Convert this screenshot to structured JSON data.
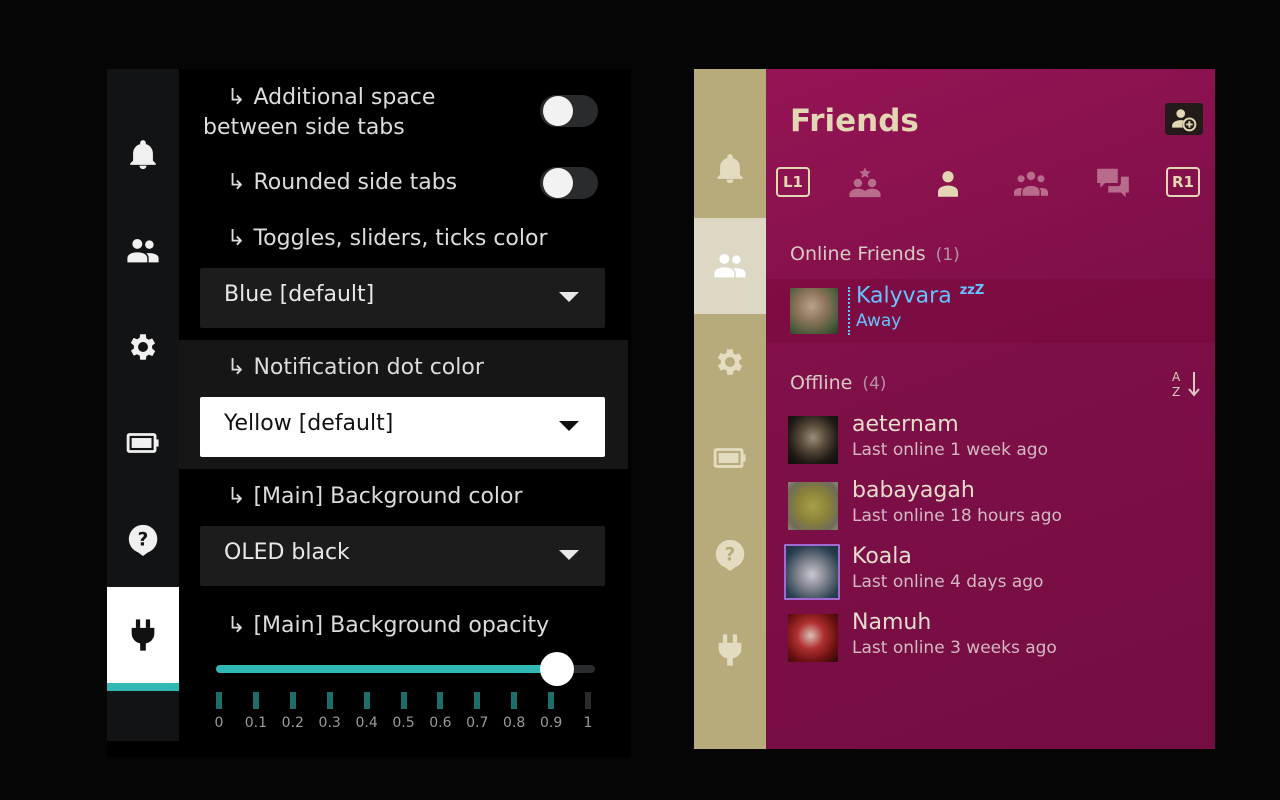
{
  "left": {
    "sidebar": [
      {
        "icon": "bell-icon",
        "active": false
      },
      {
        "icon": "friends-icon",
        "active": false
      },
      {
        "icon": "gear-icon",
        "active": false
      },
      {
        "icon": "battery-icon",
        "active": false
      },
      {
        "icon": "help-icon",
        "active": false
      },
      {
        "icon": "plug-icon",
        "active": true
      }
    ],
    "settings": {
      "additional_space_line1": "Additional space",
      "additional_space_line2": "between side tabs",
      "rounded_side_tabs": "Rounded side tabs",
      "toggles_color_label": "Toggles, sliders, ticks color",
      "toggles_color_value": "Blue [default]",
      "notif_dot_label": "Notification dot color",
      "notif_dot_value": "Yellow [default]",
      "bg_color_label": "[Main] Background color",
      "bg_color_value": "OLED black",
      "bg_opacity_label": "[Main] Background opacity",
      "arrow": "↳",
      "additional_space_on": false,
      "rounded_side_tabs_on": false
    },
    "slider": {
      "value": 0.9,
      "ticks": [
        "0",
        "0.1",
        "0.2",
        "0.3",
        "0.4",
        "0.5",
        "0.6",
        "0.7",
        "0.8",
        "0.9",
        "1"
      ]
    },
    "accent_color": "#2fb8b4"
  },
  "right": {
    "sidebar": [
      {
        "icon": "bell-icon",
        "active": false
      },
      {
        "icon": "friends-icon",
        "active": true
      },
      {
        "icon": "gear-icon",
        "active": false
      },
      {
        "icon": "battery-icon",
        "active": false
      },
      {
        "icon": "help-icon",
        "active": false
      },
      {
        "icon": "plug-icon",
        "active": false
      }
    ],
    "title": "Friends",
    "tabs": {
      "l1": "L1",
      "r1": "R1",
      "items": [
        "favorites-icon",
        "friend-icon",
        "groups-icon",
        "chat-icon"
      ],
      "active_index": 1
    },
    "online_header": "Online Friends",
    "online_count": "(1)",
    "online_friends": [
      {
        "name": "Kalyvara",
        "zzz": "zzZ",
        "status": "Away"
      }
    ],
    "offline_header": "Offline",
    "offline_count": "(4)",
    "offline_friends": [
      {
        "name": "aeternam",
        "status": "Last online 1 week ago"
      },
      {
        "name": "babayagah",
        "status": "Last online 18 hours ago"
      },
      {
        "name": "Koala",
        "status": "Last online 4 days ago"
      },
      {
        "name": "Namuh",
        "status": "Last online 3 weeks ago"
      }
    ],
    "sort_label": "A Z",
    "bg_color": "#8a1250",
    "online_color": "#66c3ff"
  }
}
